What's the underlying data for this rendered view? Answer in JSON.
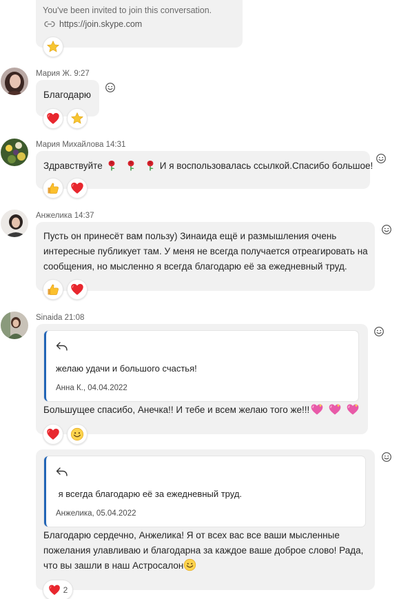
{
  "invite": {
    "text": "You've been invited to join this conversation.",
    "link": "https://join.skype.com",
    "reactions": [
      {
        "icon": "star-reaction-icon"
      }
    ]
  },
  "messages": [
    {
      "author": "Мария Ж.",
      "time": "9:27",
      "text": "Благодарю",
      "reactions": [
        "heart-reaction-icon",
        "star-reaction-icon"
      ]
    },
    {
      "author": "Мария Михайлова",
      "time": "14:31",
      "text_before": "Здравствуйте",
      "text_after": "И я воспользовалась ссылкой.Спасибо большое!",
      "reactions": [
        "thumbs-up-reaction-icon",
        "heart-reaction-icon"
      ]
    },
    {
      "author": "Анжелика",
      "time": "14:37",
      "lines": [
        "Пусть он принесёт вам пользу) Зинаида ещё и размышления очень",
        "интересные публикует там. У меня не всегда получается отреагировать на",
        "сообщения, но мысленно я всегда благодарю её за ежедневный труд."
      ],
      "reactions": [
        "thumbs-up-reaction-icon",
        "heart-reaction-icon"
      ]
    },
    {
      "author": "Sinaida",
      "time": "21:08",
      "quote_text": "желаю удачи и большого счастья!",
      "quote_meta": "Анна К., 04.04.2022",
      "text": "Большущее спасибо, Анечка!! И тебе и всем желаю того же!!!",
      "reactions": [
        "heart-reaction-icon",
        "smile-reaction-icon"
      ]
    },
    {
      "quote_text": " я всегда благодарю её за ежедневный труд.",
      "quote_meta": "Анжелика, 05.04.2022",
      "lines": [
        "Благодарю сердечно, Анжелика! Я от всех вас все ваши мысленные",
        "пожелания улавливаю и благодарна за каждое ваше доброе слово! Рада,",
        "что вы зашли в наш Астросалон"
      ],
      "reaction_count": "2"
    }
  ],
  "colors": {
    "bubble": "#f1f1f1",
    "quote_bar": "#2265b6",
    "heart": "#e8272e",
    "star": "#f7c531"
  }
}
